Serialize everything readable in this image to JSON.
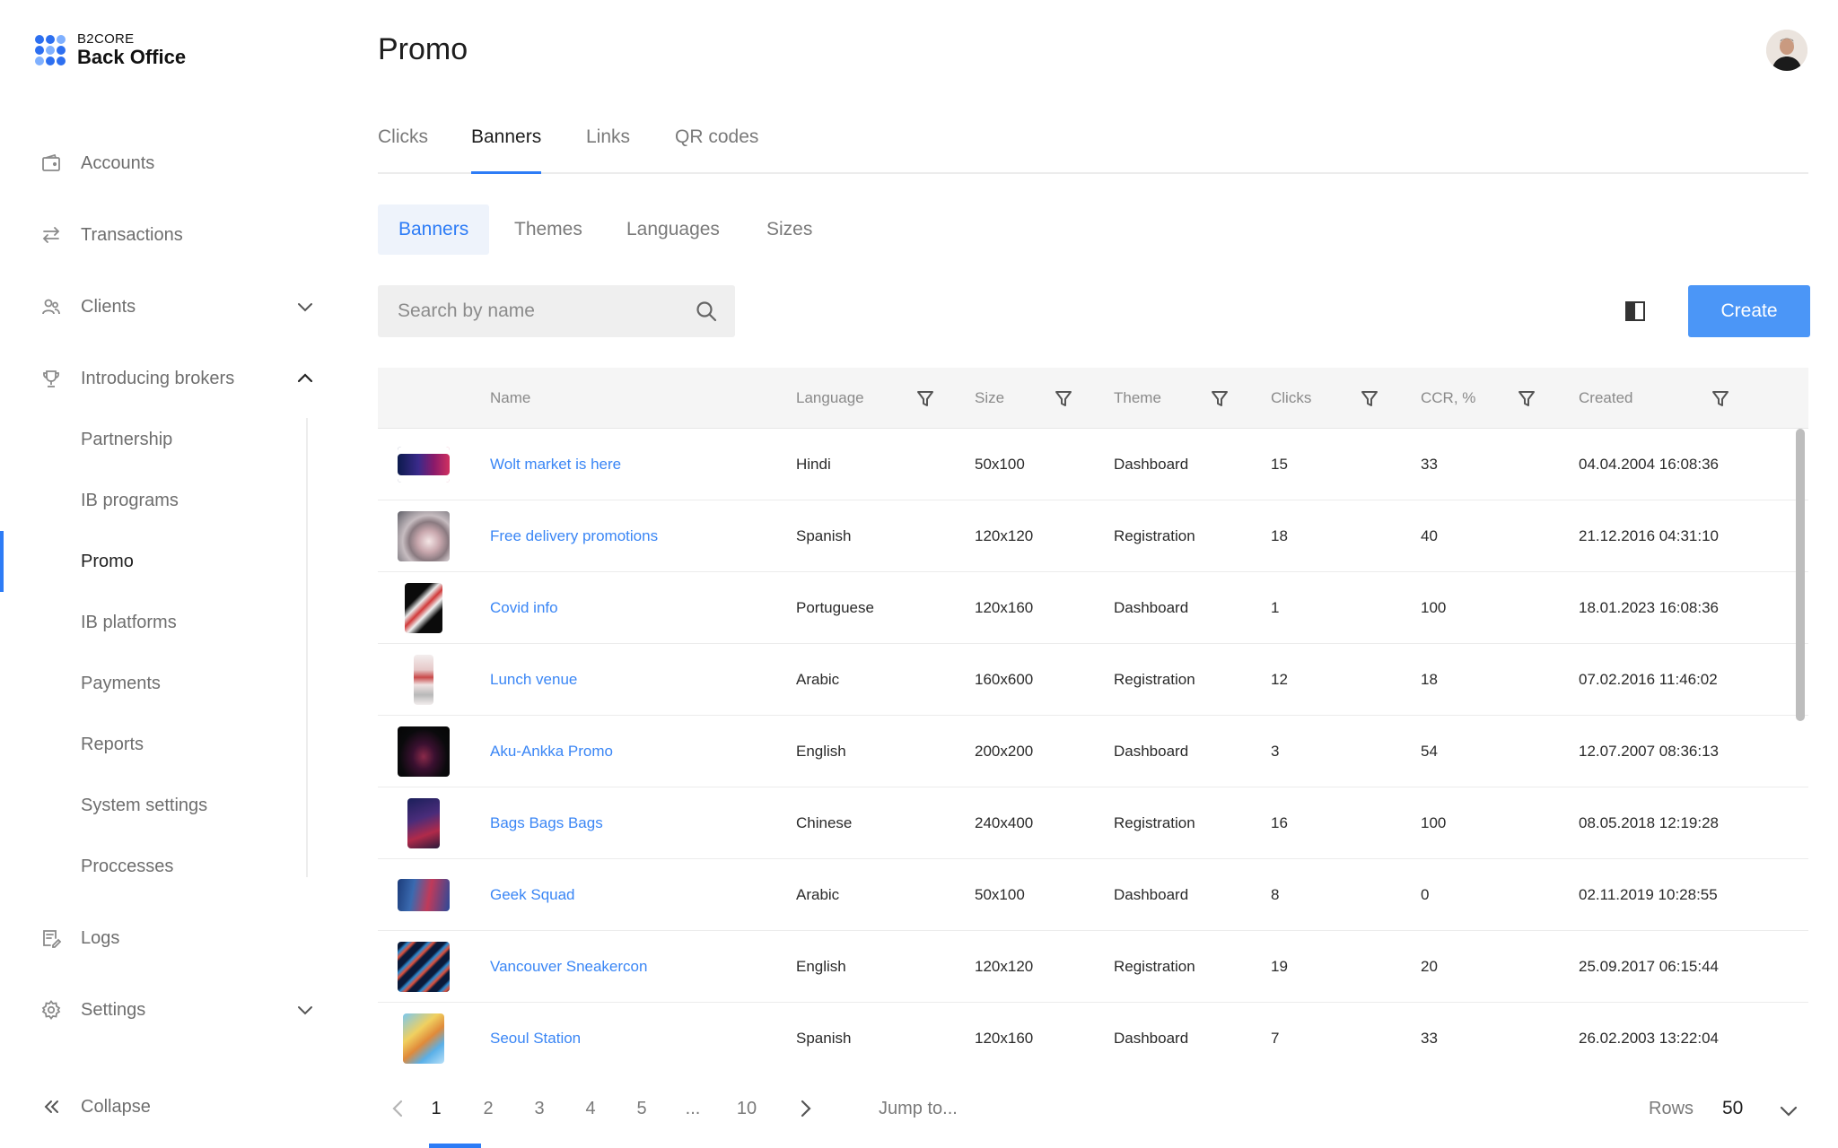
{
  "brand": {
    "small": "B2CORE",
    "big": "Back Office"
  },
  "page": {
    "title": "Promo"
  },
  "nav": {
    "accounts": "Accounts",
    "transactions": "Transactions",
    "clients": "Clients",
    "introducing_brokers": "Introducing brokers",
    "logs": "Logs",
    "settings": "Settings",
    "collapse": "Collapse"
  },
  "ib_sub": {
    "partnership": "Partnership",
    "ib_programs": "IB programs",
    "promo": "Promo",
    "ib_platforms": "IB platforms",
    "payments": "Payments",
    "reports": "Reports",
    "system_settings": "System settings",
    "processes": "Proccesses"
  },
  "tabs": {
    "clicks": "Clicks",
    "banners": "Banners",
    "links": "Links",
    "qr_codes": "QR codes"
  },
  "subtabs": {
    "banners": "Banners",
    "themes": "Themes",
    "languages": "Languages",
    "sizes": "Sizes"
  },
  "search": {
    "placeholder": "Search by name"
  },
  "toolbar": {
    "create_label": "Create"
  },
  "table": {
    "columns": {
      "name": "Name",
      "language": "Language",
      "size": "Size",
      "theme": "Theme",
      "clicks": "Clicks",
      "ccr": "CCR, %",
      "created": "Created"
    },
    "rows": [
      {
        "name": "Wolt market is here",
        "language": "Hindi",
        "size": "50x100",
        "theme": "Dashboard",
        "clicks": "15",
        "ccr": "33",
        "created": "04.04.2004 16:08:36"
      },
      {
        "name": "Free delivery promotions",
        "language": "Spanish",
        "size": "120x120",
        "theme": "Registration",
        "clicks": "18",
        "ccr": "40",
        "created": "21.12.2016 04:31:10"
      },
      {
        "name": "Covid info",
        "language": "Portuguese",
        "size": "120x160",
        "theme": "Dashboard",
        "clicks": "1",
        "ccr": "100",
        "created": "18.01.2023 16:08:36"
      },
      {
        "name": "Lunch venue",
        "language": "Arabic",
        "size": "160x600",
        "theme": "Registration",
        "clicks": "12",
        "ccr": "18",
        "created": "07.02.2016 11:46:02"
      },
      {
        "name": "Aku-Ankka Promo",
        "language": "English",
        "size": "200x200",
        "theme": "Dashboard",
        "clicks": "3",
        "ccr": "54",
        "created": "12.07.2007 08:36:13"
      },
      {
        "name": "Bags Bags Bags",
        "language": "Chinese",
        "size": "240x400",
        "theme": "Registration",
        "clicks": "16",
        "ccr": "100",
        "created": "08.05.2018 12:19:28"
      },
      {
        "name": "Geek Squad",
        "language": "Arabic",
        "size": "50x100",
        "theme": "Dashboard",
        "clicks": "8",
        "ccr": "0",
        "created": "02.11.2019 10:28:55"
      },
      {
        "name": "Vancouver Sneakercon",
        "language": "English",
        "size": "120x120",
        "theme": "Registration",
        "clicks": "19",
        "ccr": "20",
        "created": "25.09.2017 06:15:44"
      },
      {
        "name": "Seoul Station",
        "language": "Spanish",
        "size": "120x160",
        "theme": "Dashboard",
        "clicks": "7",
        "ccr": "33",
        "created": "26.02.2003 13:22:04"
      }
    ]
  },
  "pagination": {
    "pages": [
      "1",
      "2",
      "3",
      "4",
      "5",
      "...",
      "10"
    ],
    "current": "1",
    "jump_placeholder": "Jump to...",
    "rows_label": "Rows",
    "rows_value": "50"
  },
  "colors": {
    "accent": "#2d7cf6",
    "button": "#4b96f7",
    "link": "#3a86f5"
  }
}
